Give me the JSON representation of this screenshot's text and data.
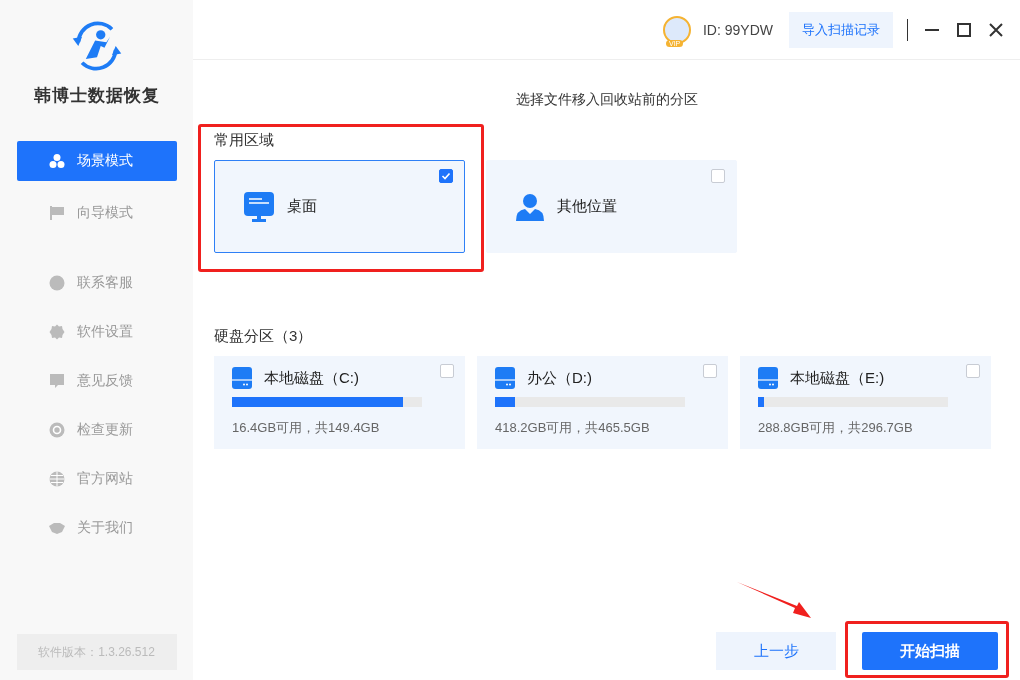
{
  "app": {
    "name": "韩博士数据恢复"
  },
  "sidebar": {
    "items": [
      {
        "label": "场景模式",
        "selected": true
      },
      {
        "label": "向导模式",
        "selected": false
      }
    ],
    "links": [
      {
        "label": "联系客服"
      },
      {
        "label": "软件设置"
      },
      {
        "label": "意见反馈"
      },
      {
        "label": "检查更新"
      },
      {
        "label": "官方网站"
      },
      {
        "label": "关于我们"
      }
    ],
    "version": "软件版本：1.3.26.512"
  },
  "header": {
    "vip_badge": "VIP",
    "user_id": "ID: 99YDW",
    "import_button": "导入扫描记录"
  },
  "prompt": "选择文件移入回收站前的分区",
  "common_area": {
    "title": "常用区域",
    "items": [
      {
        "label": "桌面",
        "checked": true,
        "kind": "desktop"
      },
      {
        "label": "其他位置",
        "checked": false,
        "kind": "user"
      }
    ]
  },
  "disks": {
    "title": "硬盘分区（3）",
    "items": [
      {
        "name": "本地磁盘（C:)",
        "level": 0.9,
        "usage": "16.4GB可用，共149.4GB",
        "checked": false
      },
      {
        "name": "办公（D:)",
        "level": 0.105,
        "usage": "418.2GB可用，共465.5GB",
        "checked": false
      },
      {
        "name": "本地磁盘（E:)",
        "level": 0.03,
        "usage": "288.8GB可用，共296.7GB",
        "checked": false
      }
    ]
  },
  "buttons": {
    "back": "上一步",
    "start": "开始扫描"
  }
}
